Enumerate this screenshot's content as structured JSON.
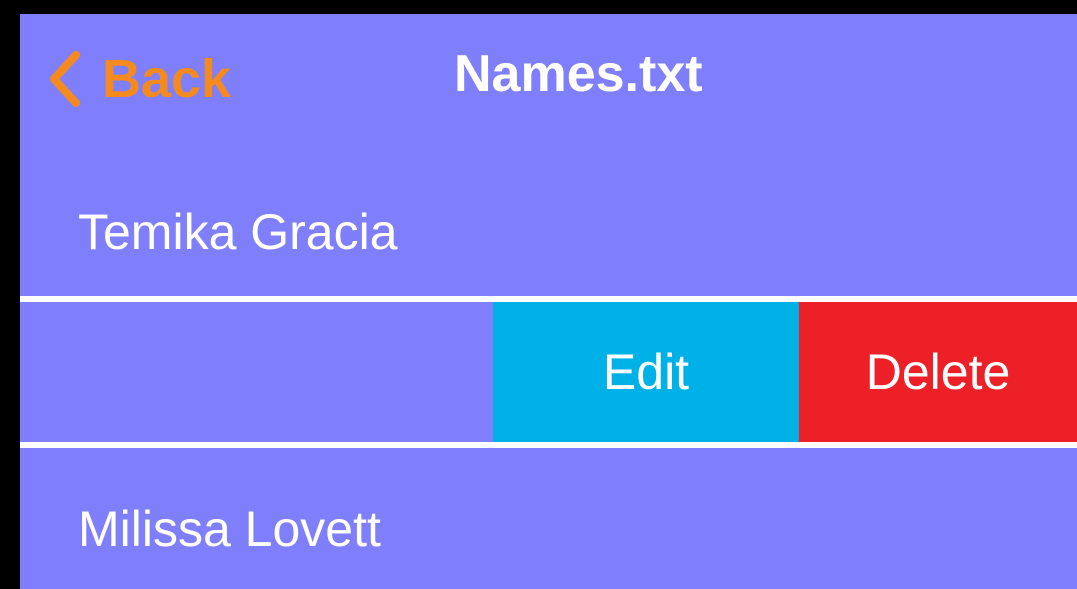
{
  "colors": {
    "background": "#7f7ffc",
    "accent": "#f58a1f",
    "edit": "#00b1e8",
    "delete": "#ee2027",
    "separator": "#ffffff"
  },
  "navbar": {
    "back_icon": "chevron-left-icon",
    "back_label": "Back",
    "title": "Names.txt"
  },
  "rows": [
    {
      "label": "Temika Gracia"
    },
    {
      "label": "",
      "actions": {
        "edit_label": "Edit",
        "delete_label": "Delete"
      }
    },
    {
      "label": "Milissa Lovett"
    }
  ]
}
